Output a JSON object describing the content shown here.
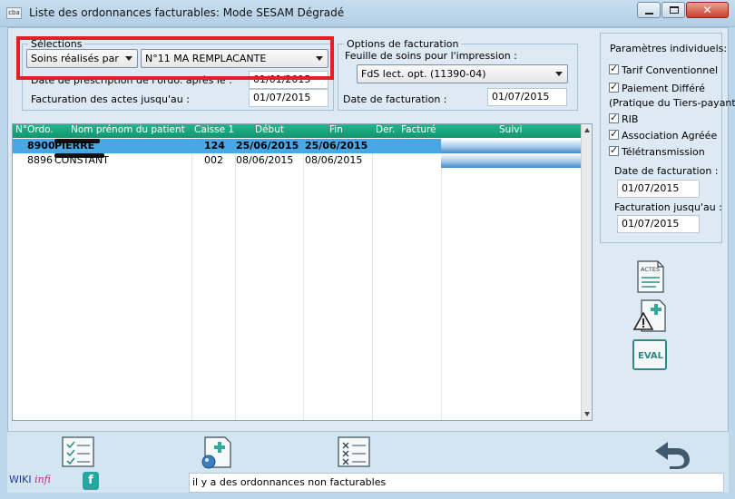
{
  "window": {
    "app_icon": "cba",
    "title": "Liste des ordonnances facturables: Mode SESAM Dégradé"
  },
  "selections": {
    "legend": "Sélections",
    "mode_select": "Soins réalisés par",
    "practitioner_select": "N°11  MA REMPLACANTE",
    "prescription_label": "Date de prescription de l'ordo. après le :",
    "prescription_value": "01/01/2015",
    "billing_until_label": "Facturation des actes jusqu'au :",
    "billing_until_value": "01/07/2015"
  },
  "billing_options": {
    "legend": "Options de facturation",
    "sheet_label": "Feuille de soins pour l'impression :",
    "sheet_select": "FdS lect. opt. (11390-04)",
    "date_label": "Date de facturation :",
    "date_value": "01/07/2015"
  },
  "table": {
    "headers": [
      "N°Ordo.",
      "Nom prénom du patient",
      "Caisse 1",
      "Début",
      "Fin",
      "Der.",
      "Facturé",
      "Suivi"
    ],
    "rows": [
      {
        "ordo": "8900",
        "name": "PIERRE",
        "caisse": "124",
        "debut": "25/06/2015",
        "fin": "25/06/2015",
        "der": "",
        "facture": ""
      },
      {
        "ordo": "8896",
        "name": "CONSTANT",
        "caisse": "002",
        "debut": "08/06/2015",
        "fin": "08/06/2015",
        "der": "",
        "facture": ""
      }
    ]
  },
  "params": {
    "title": "Paramètres individuels:",
    "items": [
      "Tarif Conventionnel",
      "Paiement Différé",
      "RIB",
      "Association Agréée",
      "Télétransmission"
    ],
    "paiement_note": "(Pratique du Tiers-payant)",
    "date_label": "Date de facturation :",
    "date_value": "01/07/2015",
    "until_label": "Facturation jusqu'au :",
    "until_value": "01/07/2015"
  },
  "side_buttons": {
    "actes": "ACTES",
    "eval": "EVAL"
  },
  "footer": {
    "wiki": "WIKI",
    "infi": "infi",
    "fb": "f",
    "status": "il y a des ordonnances non facturables"
  },
  "colors": {
    "header_green": "#12956f",
    "selected_row": "#4aa7e6",
    "highlight_red": "#e21e26"
  }
}
